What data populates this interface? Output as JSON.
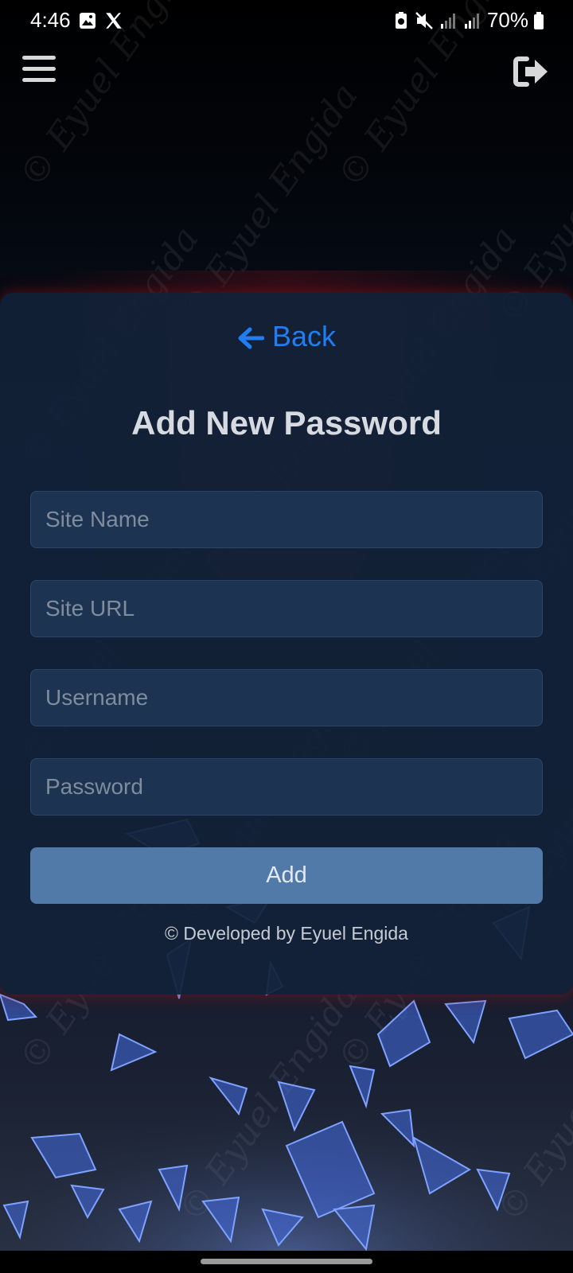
{
  "status_bar": {
    "time": "4:46",
    "battery_percent": "70%",
    "left_icons": [
      "image-icon",
      "x-icon"
    ],
    "right_icons": [
      "battery-saver-icon",
      "mute-icon",
      "signal-icon",
      "signal-icon",
      "battery-icon"
    ]
  },
  "header": {
    "menu_icon": "hamburger-menu-icon",
    "logout_icon": "logout-icon"
  },
  "form": {
    "back_label": "Back",
    "title": "Add New Password",
    "fields": {
      "site_name_placeholder": "Site Name",
      "site_url_placeholder": "Site URL",
      "username_placeholder": "Username",
      "password_placeholder": "Password"
    },
    "add_label": "Add",
    "footer": "© Developed by Eyuel Engida"
  },
  "watermark": "© Eyuel Engida",
  "colors": {
    "accent": "#1e7ef2",
    "card": "#12213a",
    "field": "#1c3352",
    "button": "#527aa8"
  }
}
